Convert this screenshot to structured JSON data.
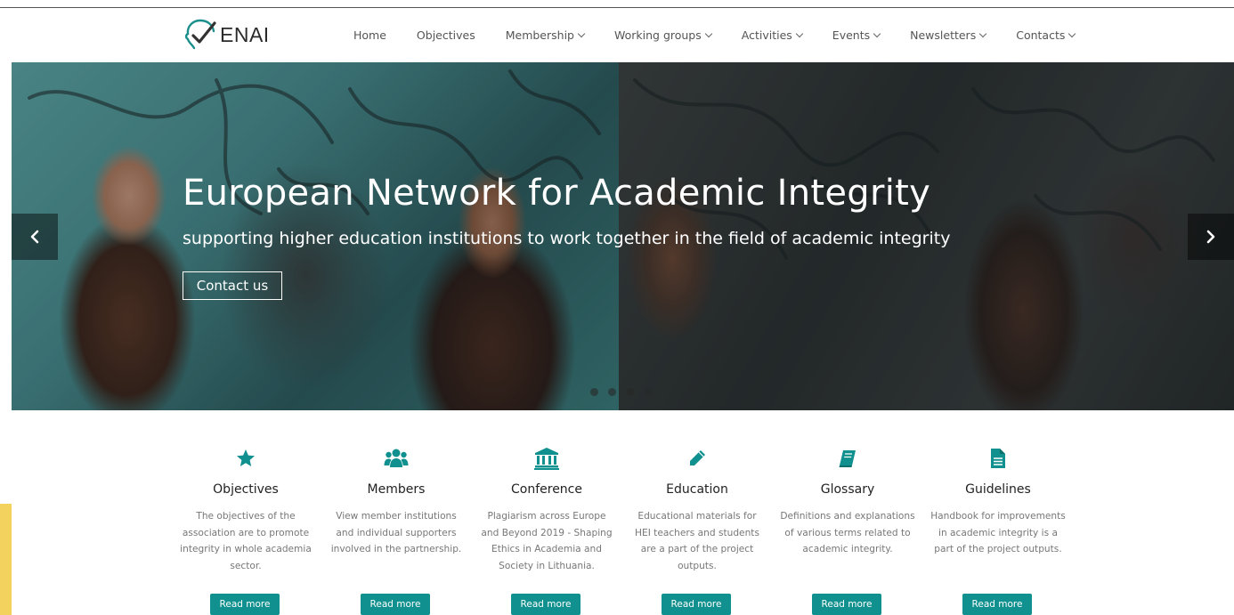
{
  "brand": {
    "name": "ENAI",
    "logo_icon": "enai-head-check-logo",
    "accent_color": "#10908e"
  },
  "nav": {
    "items": [
      {
        "label": "Home",
        "dropdown": false
      },
      {
        "label": "Objectives",
        "dropdown": false
      },
      {
        "label": "Membership",
        "dropdown": true
      },
      {
        "label": "Working groups",
        "dropdown": true
      },
      {
        "label": "Activities",
        "dropdown": true
      },
      {
        "label": "Events",
        "dropdown": true
      },
      {
        "label": "Newsletters",
        "dropdown": true
      },
      {
        "label": "Contacts",
        "dropdown": true
      }
    ]
  },
  "hero": {
    "title": "European Network for Academic Integrity",
    "subtitle": "supporting higher education institutions to work together in the field of academic integrity",
    "button_label": "Contact us",
    "prev_icon": "chevron-left-icon",
    "next_icon": "chevron-right-icon",
    "slide_count": 4
  },
  "features": [
    {
      "icon": "star-icon",
      "title": "Objectives",
      "description": "The objectives of the association are to promote integrity in whole academia sector.",
      "button": "Read more"
    },
    {
      "icon": "users-icon",
      "title": "Members",
      "description": "View member institutions and individual supporters involved in the partnership.",
      "button": "Read more"
    },
    {
      "icon": "institution-icon",
      "title": "Conference",
      "description": "Plagiarism across Europe and Beyond 2019 - Shaping Ethics in Academia and Society in Lithuania.",
      "button": "Read more"
    },
    {
      "icon": "pencil-icon",
      "title": "Education",
      "description": "Educational materials for HEI teachers and students are a part of the project outputs.",
      "button": "Read more"
    },
    {
      "icon": "book-icon",
      "title": "Glossary",
      "description": "Definitions and explanations of various terms related to academic integrity.",
      "button": "Read more"
    },
    {
      "icon": "document-icon",
      "title": "Guidelines",
      "description": "Handbook for improvements in academic integrity is a part of the project outputs.",
      "button": "Read more"
    }
  ]
}
